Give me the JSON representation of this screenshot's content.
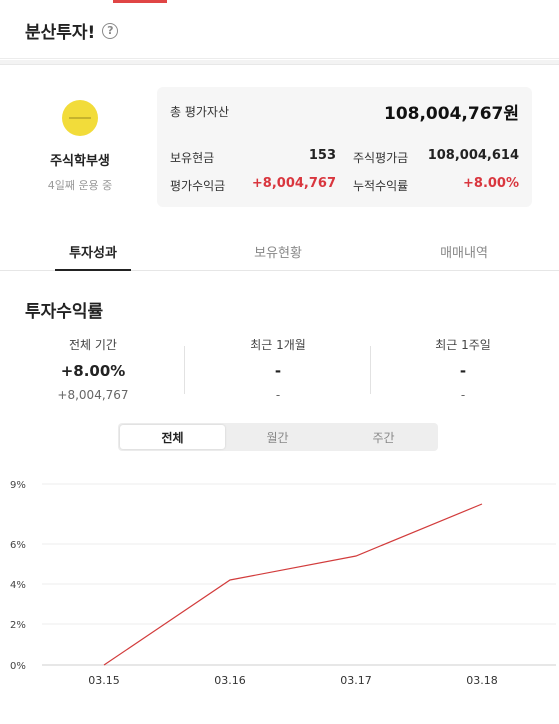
{
  "header": {
    "title": "분산투자!",
    "help_icon": "question-circle-icon"
  },
  "profile": {
    "name": "주식학부생",
    "subtitle": "4일째 운용 중",
    "avatar_color": "#f2dc3a"
  },
  "assets": {
    "total_label": "총 평가자산",
    "total_value": "108,004,767원",
    "cash_label": "보유현금",
    "cash_value": "153",
    "stock_eval_label": "주식평가금",
    "stock_eval_value": "108,004,614",
    "profit_label": "평가수익금",
    "profit_value": "+8,004,767",
    "cum_rate_label": "누적수익률",
    "cum_rate_value": "+8.00%"
  },
  "tabs": [
    {
      "label": "투자성과",
      "active": true
    },
    {
      "label": "보유현황",
      "active": false
    },
    {
      "label": "매매내역",
      "active": false
    }
  ],
  "performance": {
    "title": "투자수익률",
    "stats": [
      {
        "label": "전체 기간",
        "rate": "+8.00%",
        "amount": "+8,004,767",
        "positive": true
      },
      {
        "label": "최근 1개월",
        "rate": "-",
        "amount": "-",
        "positive": false
      },
      {
        "label": "최근 1주일",
        "rate": "-",
        "amount": "-",
        "positive": false
      }
    ],
    "periods": [
      {
        "label": "전체",
        "active": true
      },
      {
        "label": "월간",
        "active": false
      },
      {
        "label": "주간",
        "active": false
      }
    ]
  },
  "colors": {
    "accent": "#d9363e",
    "line": "#d23c3c"
  },
  "chart_data": {
    "type": "line",
    "categories": [
      "03.15",
      "03.16",
      "03.17",
      "03.18"
    ],
    "series": [
      {
        "values": [
          0,
          4.2,
          5.4,
          8.0
        ]
      }
    ],
    "yticks": [
      0,
      2,
      4,
      6,
      9
    ],
    "ytick_labels": [
      "0%",
      "2%",
      "4%",
      "6%",
      "9%"
    ],
    "ylim": [
      0,
      9
    ],
    "grid": true
  }
}
